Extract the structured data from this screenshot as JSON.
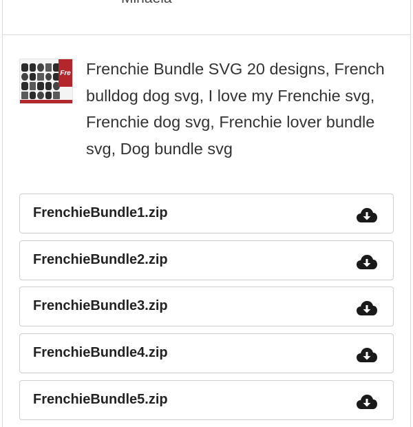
{
  "header": {
    "name": "Mihaela"
  },
  "product": {
    "title": "Frenchie Bundle SVG 20 designs, French bulldog dog svg, I love my Frenchie svg, Frenchie dog svg, Frenchie lover bundle svg, Dog bundle svg",
    "thumbnail_logo_text": "Fren"
  },
  "files": [
    {
      "name": "FrenchieBundle1.zip",
      "icon": "cloud-download-icon"
    },
    {
      "name": "FrenchieBundle2.zip",
      "icon": "cloud-download-icon"
    },
    {
      "name": "FrenchieBundle3.zip",
      "icon": "cloud-download-icon"
    },
    {
      "name": "FrenchieBundle4.zip",
      "icon": "cloud-download-icon"
    },
    {
      "name": "FrenchieBundle5.zip",
      "icon": "cloud-download-icon"
    }
  ]
}
